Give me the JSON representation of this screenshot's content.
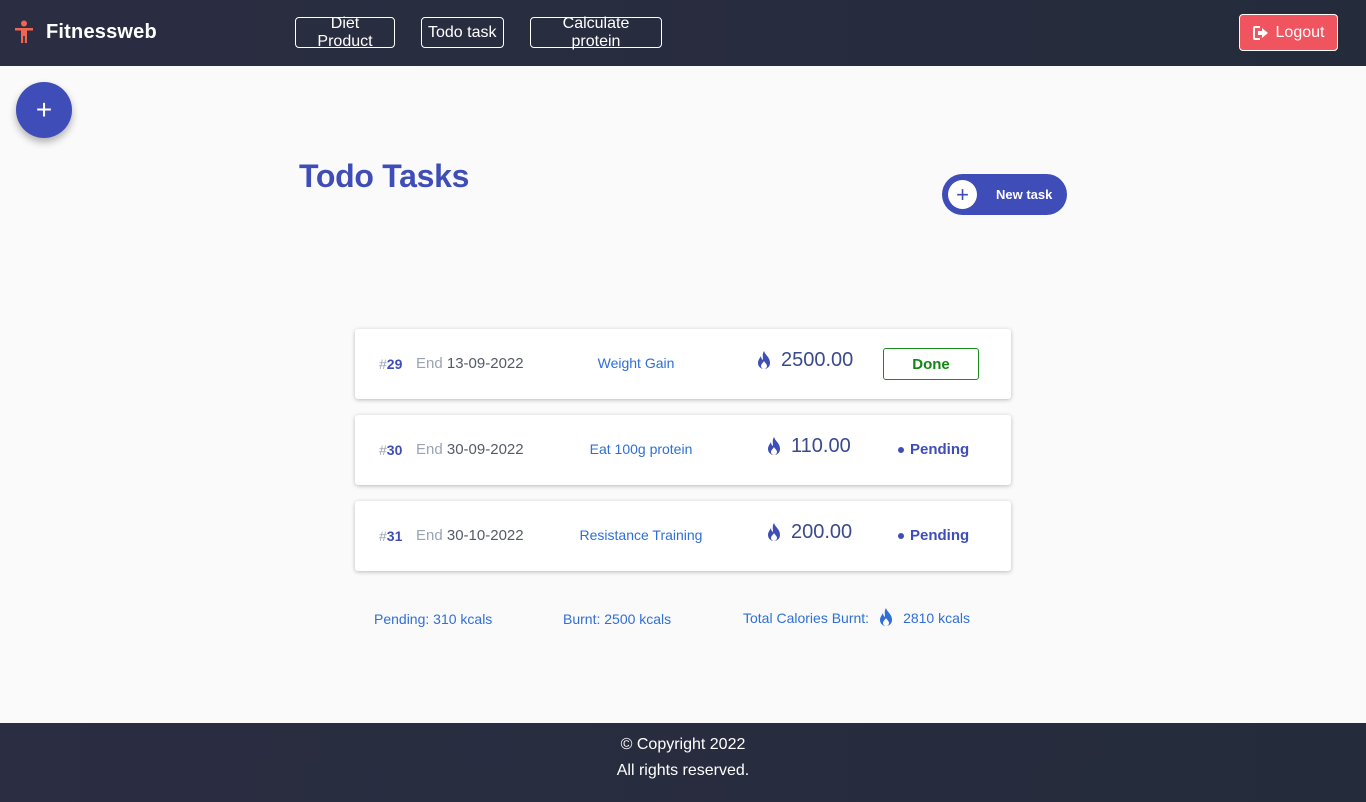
{
  "header": {
    "brand": "Fitnessweb",
    "nav": [
      "Diet Product",
      "Todo task",
      "Calculate protein"
    ],
    "logout": "Logout",
    "logout_color": "#f0545f"
  },
  "fab": {
    "symbol": "+"
  },
  "page": {
    "title": "Todo Tasks",
    "new_task": "New task",
    "new_task_symbol": "+"
  },
  "tasks": [
    {
      "hash": "#",
      "id": "29",
      "end_label": "End",
      "date": "13-09-2022",
      "name": "Weight Gain",
      "calories": "2500.00",
      "status": "Done"
    },
    {
      "hash": "#",
      "id": "30",
      "end_label": "End",
      "date": "30-09-2022",
      "name": "Eat 100g protein",
      "calories": "110.00",
      "status": "Pending"
    },
    {
      "hash": "#",
      "id": "31",
      "end_label": "End",
      "date": "30-10-2022",
      "name": "Resistance Training",
      "calories": "200.00",
      "status": "Pending"
    }
  ],
  "summary": {
    "pending": "Pending: 310 kcals",
    "burnt": "Burnt: 2500 kcals",
    "total_label": "Total Calories Burnt:",
    "total_value": "2810 kcals"
  },
  "footer": {
    "copyright": "© Copyright 2022",
    "rights": "All rights reserved."
  },
  "colors": {
    "accent": "#3f4db8",
    "link": "#2f6fd6",
    "done": "#118811",
    "header_bg": "#2b2d42"
  },
  "icons": [
    "person-icon",
    "logout-icon",
    "plus-icon",
    "flame-icon"
  ]
}
